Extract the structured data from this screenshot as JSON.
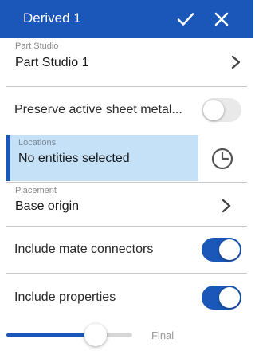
{
  "header": {
    "title": "Derived 1",
    "accent": "#1a57b9"
  },
  "part_studio": {
    "label": "Part Studio",
    "value": "Part Studio 1"
  },
  "preserve_sheet_metal": {
    "label": "Preserve active sheet metal...",
    "enabled": false
  },
  "locations": {
    "label": "Locations",
    "value": "No entities selected",
    "icon": "clock-icon"
  },
  "placement": {
    "label": "Placement",
    "value": "Base origin"
  },
  "include_mate_connectors": {
    "label": "Include mate connectors",
    "enabled": true
  },
  "include_properties": {
    "label": "Include properties",
    "enabled": true
  },
  "slider": {
    "end_label": "Final",
    "level": 0.7
  }
}
